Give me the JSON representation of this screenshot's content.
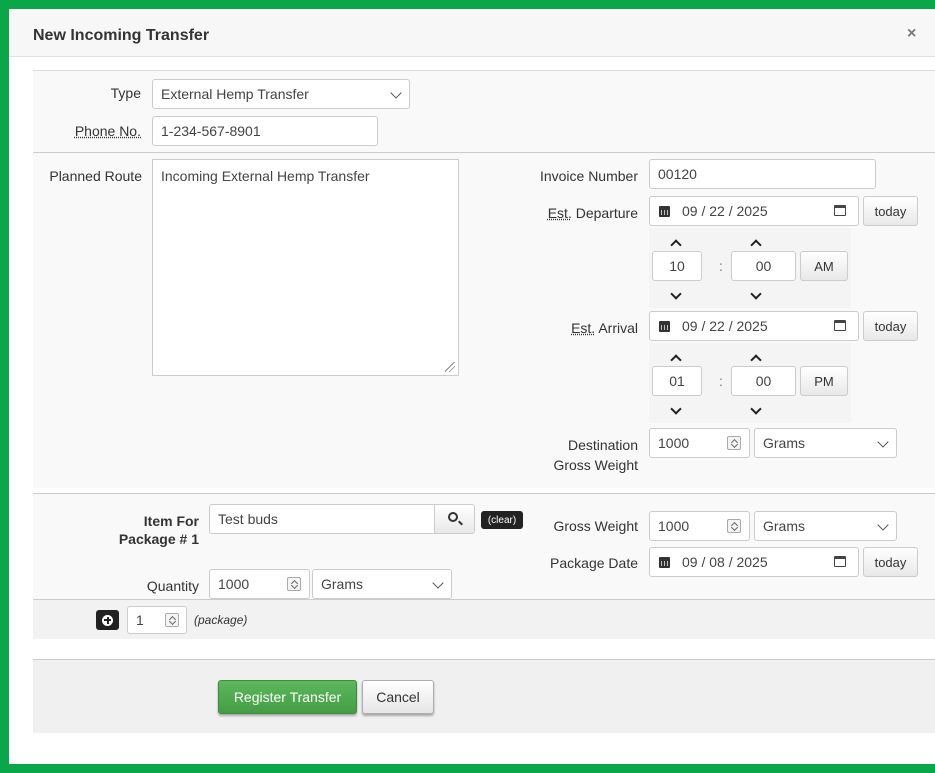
{
  "colors": {
    "frame": "#0aa64a",
    "primary_button": "#5cb85c"
  },
  "modal": {
    "title": "New Incoming Transfer",
    "close": "×"
  },
  "header_section": {
    "type_label": "Type",
    "type_value": "External Hemp Transfer",
    "phone_label": "Phone No.",
    "phone_value": "1-234-567-8901"
  },
  "route_section": {
    "planned_route_label": "Planned Route",
    "planned_route_value": "Incoming External Hemp Transfer",
    "invoice_label": "Invoice Number",
    "invoice_value": "00120",
    "departure_label_abbr": "Est.",
    "departure_label_rest": " Departure",
    "departure_date": "09 / 22 / 2025",
    "departure_hour": "10",
    "departure_minute": "00",
    "departure_ampm": "AM",
    "arrival_label_abbr": "Est.",
    "arrival_label_rest": " Arrival",
    "arrival_date": "09 / 22 / 2025",
    "arrival_hour": "01",
    "arrival_minute": "00",
    "arrival_ampm": "PM",
    "today_label": "today",
    "time_separator": ":",
    "dest_weight_label_1": "Destination",
    "dest_weight_label_2": "Gross Weight",
    "dest_weight_value": "1000",
    "dest_weight_unit": "Grams"
  },
  "package_section": {
    "item_label_1": "Item For",
    "item_label_2": "Package # 1",
    "item_value": "Test buds",
    "clear_label": "(clear)",
    "quantity_label": "Quantity",
    "quantity_value": "1000",
    "quantity_unit": "Grams",
    "gross_weight_label": "Gross Weight",
    "gross_weight_value": "1000",
    "gross_weight_unit": "Grams",
    "package_date_label": "Package Date",
    "package_date_value": "09 / 08 / 2025",
    "today_label": "today"
  },
  "add_section": {
    "count": "1",
    "unit_label": "(package)"
  },
  "footer": {
    "register_label": "Register Transfer",
    "cancel_label": "Cancel"
  }
}
